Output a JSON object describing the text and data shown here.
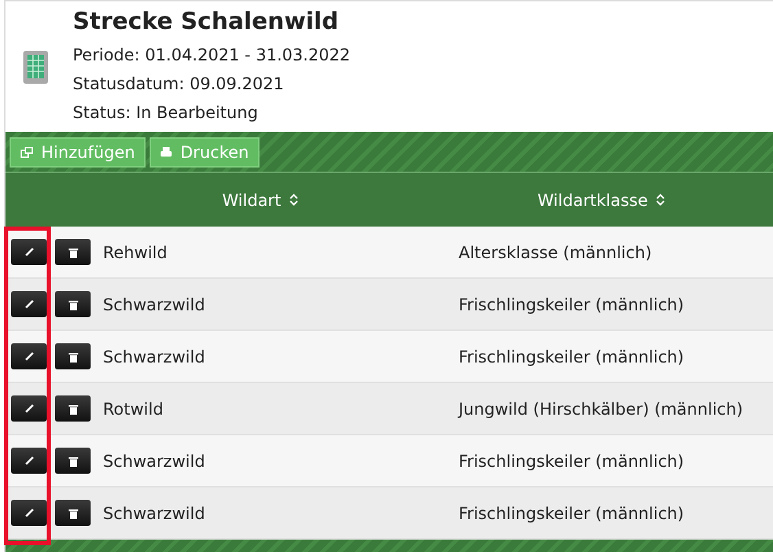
{
  "header": {
    "title": "Strecke Schalenwild",
    "lines": [
      "Periode: 01.04.2021 - 31.03.2022",
      "Statusdatum: 09.09.2021",
      "Status: In Bearbeitung"
    ]
  },
  "toolbar": [
    {
      "kind": "add",
      "label": "Hinzufügen"
    },
    {
      "kind": "print",
      "label": "Drucken"
    }
  ],
  "table": {
    "columns": [
      "Wildart",
      "Wildartklasse"
    ],
    "rows": [
      {
        "wildart": "Rehwild",
        "wildartklasse": "Altersklasse (männlich)"
      },
      {
        "wildart": "Schwarzwild",
        "wildartklasse": "Frischlingskeiler (männlich)"
      },
      {
        "wildart": "Schwarzwild",
        "wildartklasse": "Frischlingskeiler (männlich)"
      },
      {
        "wildart": "Rotwild",
        "wildartklasse": "Jungwild (Hirschkälber) (männlich)"
      },
      {
        "wildart": "Schwarzwild",
        "wildartklasse": "Frischlingskeiler (männlich)"
      },
      {
        "wildart": "Schwarzwild",
        "wildartklasse": "Frischlingskeiler (männlich)"
      }
    ]
  }
}
